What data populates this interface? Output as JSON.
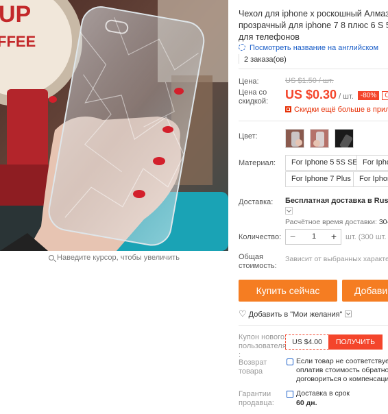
{
  "product": {
    "title_line1": "Чехол для iphone x роскошный Алмазн",
    "title_line2": "прозрачный для iphone 7 8 плюс 6 S 5",
    "title_line3": "для телефонов",
    "translate_link": "Посмотреть название на английском",
    "orders": "2 заказа(ов)"
  },
  "price": {
    "price_label": "Цена:",
    "old_price": "US $1.50 / шт.",
    "discount_label_1": "Цена со",
    "discount_label_2": "скидкой:",
    "new_price": "US $0.30",
    "unit": "/ шт.",
    "discount_badge": "-80%",
    "badge_extra": "С",
    "app_deal": "Скидки ещё больше в прилож"
  },
  "color": {
    "label": "Цвет:"
  },
  "material": {
    "label": "Материал:",
    "options": [
      "For Iphone 5 5S SE",
      "For Iphon",
      "For Iphone 7 Plus",
      "For Iphon"
    ]
  },
  "shipping": {
    "label": "Доставка:",
    "main": "Бесплатная доставка в Russian",
    "time_label": "Расчётное время доставки:",
    "time_value": "30-5"
  },
  "quantity": {
    "label": "Количество:",
    "value": "1",
    "minus": "−",
    "plus": "+",
    "note": "шт. (300 шт. –"
  },
  "total": {
    "label_1": "Общая",
    "label_2": "стоимость:",
    "value": "Зависит от выбранных характер"
  },
  "actions": {
    "buy_now": "Купить сейчас",
    "add_to_cart": "Добави",
    "wishlist": "Добавить в \"Мои желания\""
  },
  "coupon": {
    "label_1": "Купон нового",
    "label_2": "пользователя",
    "label_3": ":",
    "value": "US $4.00",
    "get": "ПОЛУЧИТЬ"
  },
  "returns": {
    "label_1": "Возврат",
    "label_2": "товара",
    "text_1": "Если товар не соответствует с",
    "text_2": "оплатив стоимость обратной",
    "text_3": "договориться о компенсаци"
  },
  "guarantee": {
    "label_1": "Гарантии",
    "label_2": "продавца:",
    "text": "Доставка в срок",
    "days": "60 дн."
  },
  "gallery": {
    "zoom_hint": "Наведите курсор, чтобы увеличить",
    "background_sign": "UP",
    "background_sign_2": "FFEE"
  },
  "colors": {
    "accent": "#f4452b",
    "button": "#f57d22",
    "link": "#1a5ec8"
  }
}
